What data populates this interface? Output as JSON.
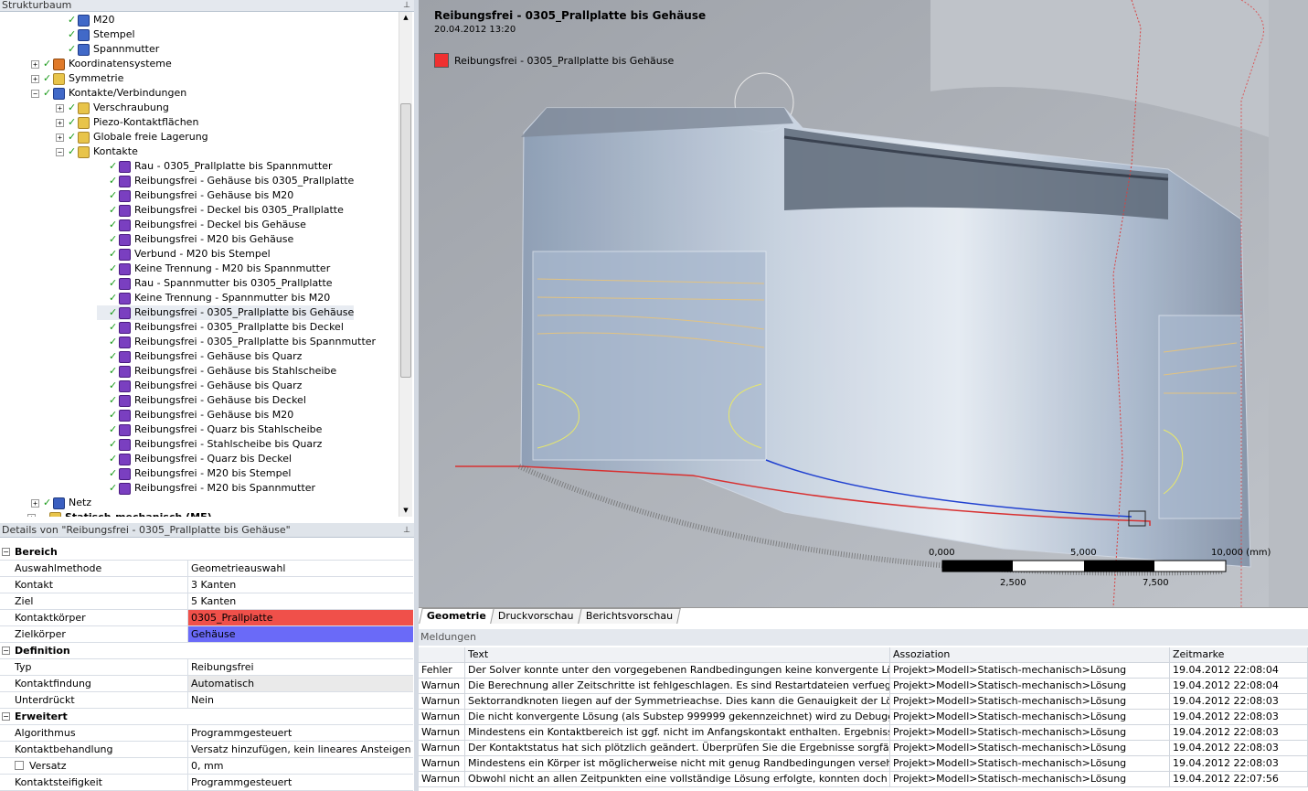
{
  "tree_panel": {
    "title": "Strukturbaum"
  },
  "tree": [
    {
      "label": "M20",
      "level": 3,
      "icon": "body-icon",
      "checked": true,
      "expander": false
    },
    {
      "label": "Stempel",
      "level": 3,
      "icon": "body-icon",
      "checked": true,
      "expander": false
    },
    {
      "label": "Spannmutter",
      "level": 3,
      "icon": "body-icon",
      "checked": true,
      "expander": false
    },
    {
      "label": "Koordinatensysteme",
      "level": 2,
      "icon": "coordinate-system-icon",
      "checked": true,
      "expander": "+"
    },
    {
      "label": "Symmetrie",
      "level": 2,
      "icon": "symmetry-icon",
      "checked": true,
      "expander": "+"
    },
    {
      "label": "Kontakte/Verbindungen",
      "level": 2,
      "icon": "connections-icon",
      "checked": true,
      "expander": "−"
    },
    {
      "label": "Verschraubung",
      "level": 3,
      "icon": "folder-icon",
      "checked": true,
      "expander": "+"
    },
    {
      "label": "Piezo-Kontaktflächen",
      "level": 3,
      "icon": "folder-icon",
      "checked": true,
      "expander": "+"
    },
    {
      "label": "Globale freie Lagerung",
      "level": 3,
      "icon": "folder-icon",
      "checked": true,
      "expander": "+"
    },
    {
      "label": "Kontakte",
      "level": 3,
      "icon": "folder-icon",
      "checked": true,
      "expander": "−"
    },
    {
      "label": "Rau - 0305_Prallplatte bis Spannmutter",
      "level": 4,
      "icon": "contact-icon",
      "checked": true
    },
    {
      "label": "Reibungsfrei - Gehäuse bis 0305_Prallplatte",
      "level": 4,
      "icon": "contact-icon",
      "checked": true
    },
    {
      "label": "Reibungsfrei - Gehäuse bis M20",
      "level": 4,
      "icon": "contact-icon",
      "checked": true
    },
    {
      "label": "Reibungsfrei - Deckel bis 0305_Prallplatte",
      "level": 4,
      "icon": "contact-icon",
      "checked": true
    },
    {
      "label": "Reibungsfrei - Deckel bis Gehäuse",
      "level": 4,
      "icon": "contact-icon",
      "checked": true
    },
    {
      "label": "Reibungsfrei - M20 bis Gehäuse",
      "level": 4,
      "icon": "contact-icon",
      "checked": true
    },
    {
      "label": "Verbund - M20 bis Stempel",
      "level": 4,
      "icon": "contact-icon",
      "checked": true
    },
    {
      "label": "Keine Trennung - M20 bis Spannmutter",
      "level": 4,
      "icon": "contact-icon",
      "checked": true
    },
    {
      "label": "Rau - Spannmutter bis 0305_Prallplatte",
      "level": 4,
      "icon": "contact-icon",
      "checked": true
    },
    {
      "label": "Keine Trennung - Spannmutter bis M20",
      "level": 4,
      "icon": "contact-icon",
      "checked": true
    },
    {
      "label": "Reibungsfrei - 0305_Prallplatte bis Gehäuse",
      "level": 4,
      "icon": "contact-icon",
      "checked": true,
      "selected": true
    },
    {
      "label": "Reibungsfrei - 0305_Prallplatte bis Deckel",
      "level": 4,
      "icon": "contact-icon",
      "checked": true
    },
    {
      "label": "Reibungsfrei - 0305_Prallplatte bis Spannmutter",
      "level": 4,
      "icon": "contact-icon",
      "checked": true
    },
    {
      "label": "Reibungsfrei - Gehäuse bis Quarz",
      "level": 4,
      "icon": "contact-icon",
      "checked": true
    },
    {
      "label": "Reibungsfrei - Gehäuse bis Stahlscheibe",
      "level": 4,
      "icon": "contact-icon",
      "checked": true
    },
    {
      "label": "Reibungsfrei - Gehäuse bis Quarz",
      "level": 4,
      "icon": "contact-icon",
      "checked": true
    },
    {
      "label": "Reibungsfrei - Gehäuse bis Deckel",
      "level": 4,
      "icon": "contact-icon",
      "checked": true
    },
    {
      "label": "Reibungsfrei - Gehäuse bis M20",
      "level": 4,
      "icon": "contact-icon",
      "checked": true
    },
    {
      "label": "Reibungsfrei - Quarz bis Stahlscheibe",
      "level": 4,
      "icon": "contact-icon",
      "checked": true
    },
    {
      "label": "Reibungsfrei - Stahlscheibe bis Quarz",
      "level": 4,
      "icon": "contact-icon",
      "checked": true
    },
    {
      "label": "Reibungsfrei - Quarz bis Deckel",
      "level": 4,
      "icon": "contact-icon",
      "checked": true
    },
    {
      "label": "Reibungsfrei - M20 bis Stempel",
      "level": 4,
      "icon": "contact-icon",
      "checked": true
    },
    {
      "label": "Reibungsfrei - M20 bis Spannmutter",
      "level": 4,
      "icon": "contact-icon",
      "checked": true
    },
    {
      "label": "Netz",
      "level": 2,
      "icon": "mesh-icon",
      "checked": true,
      "expander": "+"
    },
    {
      "label": "Statisch-mechanisch (ME)",
      "level": 1,
      "icon": "analysis-icon",
      "checked": false,
      "expander": "+"
    }
  ],
  "details": {
    "title": "Details von \"Reibungsfrei - 0305_Prallplatte bis Gehäuse\"",
    "rows": [
      {
        "section": "Bereich"
      },
      {
        "key": "Auswahlmethode",
        "value": "Geometrieauswahl"
      },
      {
        "key": "Kontakt",
        "value": "3 Kanten"
      },
      {
        "key": "Ziel",
        "value": "5 Kanten"
      },
      {
        "key": "Kontaktkörper",
        "value": "0305_Prallplatte",
        "color": "#f0504a"
      },
      {
        "key": "Zielkörper",
        "value": "Gehäuse",
        "color": "#6a6af8"
      },
      {
        "section": "Definition"
      },
      {
        "key": "Typ",
        "value": "Reibungsfrei"
      },
      {
        "key": "Kontaktfindung",
        "value": "Automatisch",
        "color": "#eaeaea"
      },
      {
        "key": "Unterdrückt",
        "value": "Nein"
      },
      {
        "section": "Erweitert"
      },
      {
        "key": "Algorithmus",
        "value": "Programmgesteuert"
      },
      {
        "key": "Kontaktbehandlung",
        "value": "Versatz hinzufügen, kein lineares Ansteigen"
      },
      {
        "key": "Versatz",
        "value": "0, mm",
        "checkbox": true
      },
      {
        "key": "Kontaktsteifigkeit",
        "value": "Programmgesteuert"
      }
    ]
  },
  "viewport": {
    "title": "Reibungsfrei - 0305_Prallplatte bis Gehäuse",
    "timestamp": "20.04.2012 13:20",
    "legend_label": "Reibungsfrei - 0305_Prallplatte bis Gehäuse",
    "legend_color": "#f03030",
    "scale": {
      "top_labels": [
        "0,000",
        "5,000",
        "10,000 (mm)"
      ],
      "bottom_labels": [
        "2,500",
        "7,500"
      ]
    }
  },
  "tabs": [
    "Geometrie",
    "Druckvorschau",
    "Berichtsvorschau"
  ],
  "messages": {
    "title": "Meldungen",
    "columns": [
      "",
      "Text",
      "Assoziation",
      "Zeitmarke"
    ],
    "rows": [
      [
        "Fehler",
        "Der Solver konnte unter den vorgegebenen Randbedingungen keine konvergente Lösung",
        "Projekt>Modell>Statisch-mechanisch>Lösung",
        "19.04.2012 22:08:04"
      ],
      [
        "Warnun",
        "Die Berechnung aller Zeitschritte ist fehlgeschlagen. Es sind Restartdateien verfuegbar, u",
        "Projekt>Modell>Statisch-mechanisch>Lösung",
        "19.04.2012 22:08:04"
      ],
      [
        "Warnun",
        "Sektorrandknoten liegen auf der Symmetrieachse. Dies kann die Genauigkeit der Lösung",
        "Projekt>Modell>Statisch-mechanisch>Lösung",
        "19.04.2012 22:08:03"
      ],
      [
        "Warnun",
        "Die nicht konvergente Lösung (als Substep 999999 gekennzeichnet) wird zu Debugging-",
        "Projekt>Modell>Statisch-mechanisch>Lösung",
        "19.04.2012 22:08:03"
      ],
      [
        "Warnun",
        "Mindestens ein Kontaktbereich ist ggf. nicht im Anfangskontakt enthalten.  Ergebnisse",
        "Projekt>Modell>Statisch-mechanisch>Lösung",
        "19.04.2012 22:08:03"
      ],
      [
        "Warnun",
        "Der Kontaktstatus hat sich plötzlich geändert.  Überprüfen Sie die Ergebnisse sorgfältig a",
        "Projekt>Modell>Statisch-mechanisch>Lösung",
        "19.04.2012 22:08:03"
      ],
      [
        "Warnun",
        "Mindestens ein Körper ist möglicherweise nicht mit genug Randbedingungen versehen",
        "Projekt>Modell>Statisch-mechanisch>Lösung",
        "19.04.2012 22:08:03"
      ],
      [
        "Warnun",
        "Obwohl nicht an allen Zeitpunkten eine vollständige Lösung erfolgte, konnten doch an",
        "Projekt>Modell>Statisch-mechanisch>Lösung",
        "19.04.2012 22:07:56"
      ]
    ]
  }
}
